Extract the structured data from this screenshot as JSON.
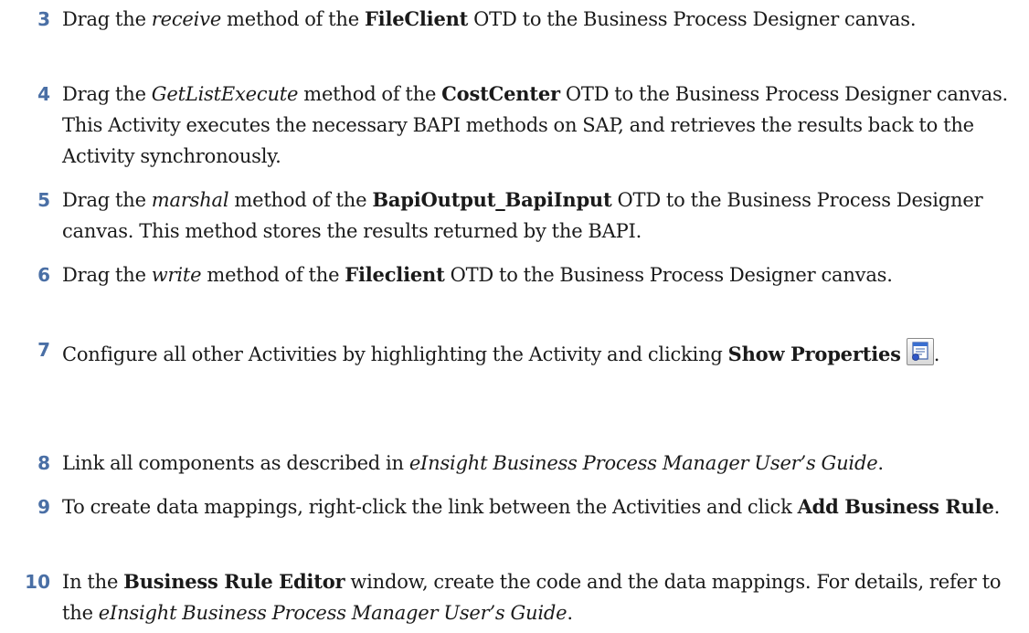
{
  "steps": [
    {
      "number": "3",
      "parts": [
        "Drag the ",
        "receive",
        " method of the ",
        "FileClient",
        " OTD to the Business Process Designer canvas."
      ]
    },
    {
      "number": "4",
      "parts": [
        "Drag the ",
        "GetListExecute",
        " method of the ",
        "CostCenter",
        " OTD to the Business Process Designer canvas. This Activity executes the necessary BAPI methods on SAP, and retrieves the results back to the Activity synchronously."
      ]
    },
    {
      "number": "5",
      "parts": [
        "Drag the ",
        "marshal",
        " method of the ",
        "BapiOutput_BapiInput",
        " OTD to the Business Process Designer canvas. This method stores the results returned by the BAPI."
      ]
    },
    {
      "number": "6",
      "parts": [
        "Drag the ",
        "write",
        " method of the ",
        "Fileclient",
        " OTD to the Business Process Designer canvas."
      ]
    },
    {
      "number": "7",
      "parts": [
        "Configure all other Activities by highlighting the Activity and clicking ",
        "Show Properties",
        "."
      ],
      "icon": "show-properties-icon"
    },
    {
      "number": "8",
      "parts": [
        "Link all components as described in ",
        "eInsight Business Process Manager User’s Guide",
        "."
      ]
    },
    {
      "number": "9",
      "parts": [
        "To create data mappings, right-click the link between the Activities and click ",
        "Add Business Rule",
        "."
      ]
    },
    {
      "number": "10",
      "parts": [
        "In the ",
        "Business Rule Editor",
        " window, create the code and the data mappings. For details, refer to the ",
        "eInsight Business Process Manager User’s Guide",
        "."
      ]
    }
  ]
}
